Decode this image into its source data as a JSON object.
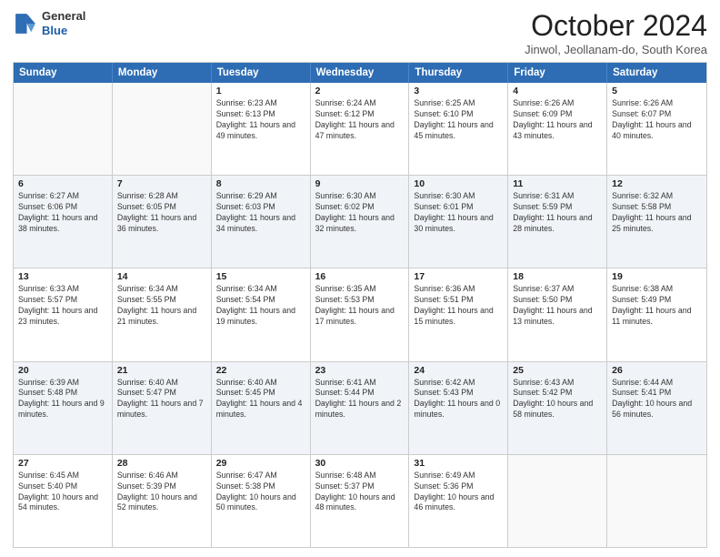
{
  "header": {
    "logo_line1": "General",
    "logo_line2": "Blue",
    "month_title": "October 2024",
    "location": "Jinwol, Jeollanam-do, South Korea"
  },
  "weekdays": [
    "Sunday",
    "Monday",
    "Tuesday",
    "Wednesday",
    "Thursday",
    "Friday",
    "Saturday"
  ],
  "weeks": [
    [
      {
        "day": "",
        "sunrise": "",
        "sunset": "",
        "daylight": "",
        "empty": true
      },
      {
        "day": "",
        "sunrise": "",
        "sunset": "",
        "daylight": "",
        "empty": true
      },
      {
        "day": "1",
        "sunrise": "Sunrise: 6:23 AM",
        "sunset": "Sunset: 6:13 PM",
        "daylight": "Daylight: 11 hours and 49 minutes."
      },
      {
        "day": "2",
        "sunrise": "Sunrise: 6:24 AM",
        "sunset": "Sunset: 6:12 PM",
        "daylight": "Daylight: 11 hours and 47 minutes."
      },
      {
        "day": "3",
        "sunrise": "Sunrise: 6:25 AM",
        "sunset": "Sunset: 6:10 PM",
        "daylight": "Daylight: 11 hours and 45 minutes."
      },
      {
        "day": "4",
        "sunrise": "Sunrise: 6:26 AM",
        "sunset": "Sunset: 6:09 PM",
        "daylight": "Daylight: 11 hours and 43 minutes."
      },
      {
        "day": "5",
        "sunrise": "Sunrise: 6:26 AM",
        "sunset": "Sunset: 6:07 PM",
        "daylight": "Daylight: 11 hours and 40 minutes."
      }
    ],
    [
      {
        "day": "6",
        "sunrise": "Sunrise: 6:27 AM",
        "sunset": "Sunset: 6:06 PM",
        "daylight": "Daylight: 11 hours and 38 minutes."
      },
      {
        "day": "7",
        "sunrise": "Sunrise: 6:28 AM",
        "sunset": "Sunset: 6:05 PM",
        "daylight": "Daylight: 11 hours and 36 minutes."
      },
      {
        "day": "8",
        "sunrise": "Sunrise: 6:29 AM",
        "sunset": "Sunset: 6:03 PM",
        "daylight": "Daylight: 11 hours and 34 minutes."
      },
      {
        "day": "9",
        "sunrise": "Sunrise: 6:30 AM",
        "sunset": "Sunset: 6:02 PM",
        "daylight": "Daylight: 11 hours and 32 minutes."
      },
      {
        "day": "10",
        "sunrise": "Sunrise: 6:30 AM",
        "sunset": "Sunset: 6:01 PM",
        "daylight": "Daylight: 11 hours and 30 minutes."
      },
      {
        "day": "11",
        "sunrise": "Sunrise: 6:31 AM",
        "sunset": "Sunset: 5:59 PM",
        "daylight": "Daylight: 11 hours and 28 minutes."
      },
      {
        "day": "12",
        "sunrise": "Sunrise: 6:32 AM",
        "sunset": "Sunset: 5:58 PM",
        "daylight": "Daylight: 11 hours and 25 minutes."
      }
    ],
    [
      {
        "day": "13",
        "sunrise": "Sunrise: 6:33 AM",
        "sunset": "Sunset: 5:57 PM",
        "daylight": "Daylight: 11 hours and 23 minutes."
      },
      {
        "day": "14",
        "sunrise": "Sunrise: 6:34 AM",
        "sunset": "Sunset: 5:55 PM",
        "daylight": "Daylight: 11 hours and 21 minutes."
      },
      {
        "day": "15",
        "sunrise": "Sunrise: 6:34 AM",
        "sunset": "Sunset: 5:54 PM",
        "daylight": "Daylight: 11 hours and 19 minutes."
      },
      {
        "day": "16",
        "sunrise": "Sunrise: 6:35 AM",
        "sunset": "Sunset: 5:53 PM",
        "daylight": "Daylight: 11 hours and 17 minutes."
      },
      {
        "day": "17",
        "sunrise": "Sunrise: 6:36 AM",
        "sunset": "Sunset: 5:51 PM",
        "daylight": "Daylight: 11 hours and 15 minutes."
      },
      {
        "day": "18",
        "sunrise": "Sunrise: 6:37 AM",
        "sunset": "Sunset: 5:50 PM",
        "daylight": "Daylight: 11 hours and 13 minutes."
      },
      {
        "day": "19",
        "sunrise": "Sunrise: 6:38 AM",
        "sunset": "Sunset: 5:49 PM",
        "daylight": "Daylight: 11 hours and 11 minutes."
      }
    ],
    [
      {
        "day": "20",
        "sunrise": "Sunrise: 6:39 AM",
        "sunset": "Sunset: 5:48 PM",
        "daylight": "Daylight: 11 hours and 9 minutes."
      },
      {
        "day": "21",
        "sunrise": "Sunrise: 6:40 AM",
        "sunset": "Sunset: 5:47 PM",
        "daylight": "Daylight: 11 hours and 7 minutes."
      },
      {
        "day": "22",
        "sunrise": "Sunrise: 6:40 AM",
        "sunset": "Sunset: 5:45 PM",
        "daylight": "Daylight: 11 hours and 4 minutes."
      },
      {
        "day": "23",
        "sunrise": "Sunrise: 6:41 AM",
        "sunset": "Sunset: 5:44 PM",
        "daylight": "Daylight: 11 hours and 2 minutes."
      },
      {
        "day": "24",
        "sunrise": "Sunrise: 6:42 AM",
        "sunset": "Sunset: 5:43 PM",
        "daylight": "Daylight: 11 hours and 0 minutes."
      },
      {
        "day": "25",
        "sunrise": "Sunrise: 6:43 AM",
        "sunset": "Sunset: 5:42 PM",
        "daylight": "Daylight: 10 hours and 58 minutes."
      },
      {
        "day": "26",
        "sunrise": "Sunrise: 6:44 AM",
        "sunset": "Sunset: 5:41 PM",
        "daylight": "Daylight: 10 hours and 56 minutes."
      }
    ],
    [
      {
        "day": "27",
        "sunrise": "Sunrise: 6:45 AM",
        "sunset": "Sunset: 5:40 PM",
        "daylight": "Daylight: 10 hours and 54 minutes."
      },
      {
        "day": "28",
        "sunrise": "Sunrise: 6:46 AM",
        "sunset": "Sunset: 5:39 PM",
        "daylight": "Daylight: 10 hours and 52 minutes."
      },
      {
        "day": "29",
        "sunrise": "Sunrise: 6:47 AM",
        "sunset": "Sunset: 5:38 PM",
        "daylight": "Daylight: 10 hours and 50 minutes."
      },
      {
        "day": "30",
        "sunrise": "Sunrise: 6:48 AM",
        "sunset": "Sunset: 5:37 PM",
        "daylight": "Daylight: 10 hours and 48 minutes."
      },
      {
        "day": "31",
        "sunrise": "Sunrise: 6:49 AM",
        "sunset": "Sunset: 5:36 PM",
        "daylight": "Daylight: 10 hours and 46 minutes."
      },
      {
        "day": "",
        "sunrise": "",
        "sunset": "",
        "daylight": "",
        "empty": true
      },
      {
        "day": "",
        "sunrise": "",
        "sunset": "",
        "daylight": "",
        "empty": true
      }
    ]
  ]
}
